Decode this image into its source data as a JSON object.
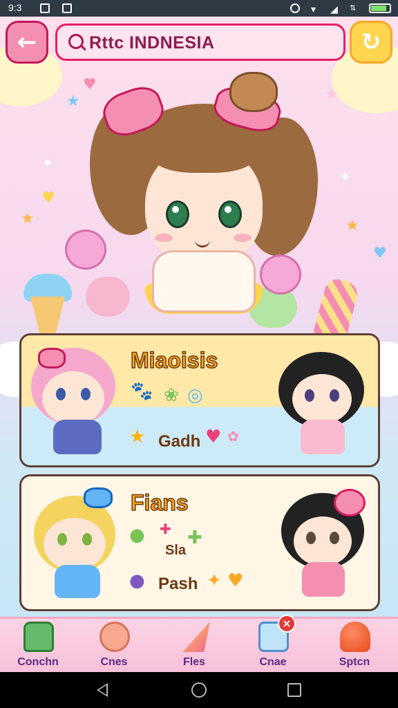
{
  "status_bar": {
    "time": "9:3"
  },
  "header": {
    "title": "Rttc INDNESIA"
  },
  "cards": [
    {
      "title": "Miaoisis",
      "item_label": "Gadh"
    },
    {
      "title": "Fians",
      "item_label_top": "Sla",
      "item_label": "Pash"
    }
  ],
  "nav": {
    "items": [
      {
        "label": "Conchn"
      },
      {
        "label": "Cnes"
      },
      {
        "label": "Fles"
      },
      {
        "label": "Cnae"
      },
      {
        "label": "Sptcn"
      }
    ]
  },
  "colors": {
    "accent_pink": "#e91e63",
    "accent_yellow": "#ffd54f",
    "title_orange": "#f6a623",
    "nav_label": "#5b2a86",
    "badge_red": "#e53935"
  }
}
